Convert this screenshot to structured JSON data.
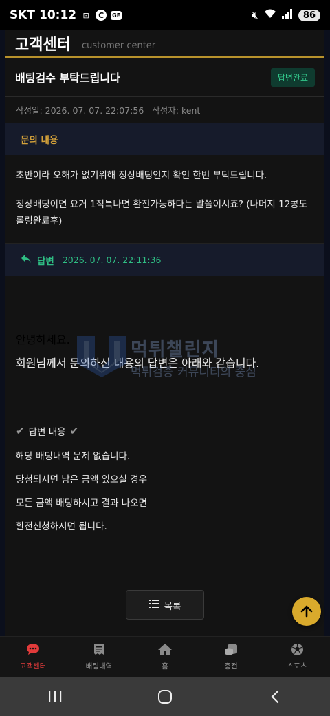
{
  "status_bar": {
    "carrier": "SKT",
    "time": "10:12",
    "battery": "86"
  },
  "header": {
    "title": "고객센터",
    "subtitle": "customer center"
  },
  "post": {
    "title": "배팅검수 부탁드립니다",
    "status_badge": "답변완료",
    "date_label": "작성일: 2026. 07. 07. 22:07:56",
    "author_label": "작성자: kent"
  },
  "question": {
    "label": "문의 내용",
    "paragraphs": [
      "초반이라 오해가 없기위해 정상배팅인지 확인 한번 부탁드립니다.",
      "정상배팅이면 요거 1적특나면 환전가능하다는 말씀이시죠? (나머지 12콩도 롤링완료후)"
    ]
  },
  "answer": {
    "label": "답변",
    "date": "2026. 07. 07. 22:11:36",
    "lines": [
      "안녕하세요.",
      "회원님께서 문의하신 내용의 답변은 아래와 같습니다.",
      "답변 내용",
      "해당 배팅내역 문제 없습니다.",
      "당첨되시면 남은 금액 있으실 경우",
      "모든 금액 배팅하시고 결과 나오면",
      "환전신청하시면 됩니다."
    ]
  },
  "watermark": {
    "line1": "먹튀챌린지",
    "line2": "먹튀검증 커뮤니티의 중심"
  },
  "list_button": {
    "label": "목록"
  },
  "tabbar": {
    "items": [
      {
        "label": "고객센터",
        "icon": "chat-icon",
        "active": true
      },
      {
        "label": "배팅내역",
        "icon": "receipt-icon",
        "active": false
      },
      {
        "label": "홈",
        "icon": "home-icon",
        "active": false
      },
      {
        "label": "충전",
        "icon": "coins-icon",
        "active": false
      },
      {
        "label": "스포츠",
        "icon": "soccer-ball-icon",
        "active": false
      }
    ]
  },
  "colors": {
    "accent_gold": "#d9aa2c",
    "answer_green": "#2fbe84",
    "active_tab_red": "#e23b3b"
  }
}
